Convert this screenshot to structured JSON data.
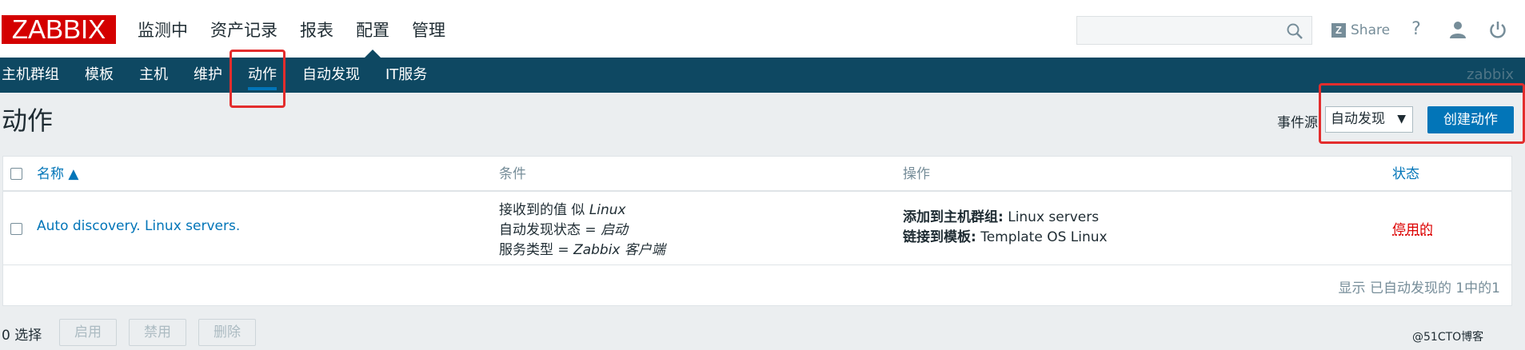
{
  "header": {
    "logo": "ZABBIX",
    "menu": [
      {
        "label": "监测中"
      },
      {
        "label": "资产记录"
      },
      {
        "label": "报表"
      },
      {
        "label": "配置"
      },
      {
        "label": "管理"
      }
    ],
    "search_value": "",
    "share_label": "Share",
    "help_label": "?"
  },
  "subnav": {
    "items": [
      {
        "label": "主机群组"
      },
      {
        "label": "模板"
      },
      {
        "label": "主机"
      },
      {
        "label": "维护"
      },
      {
        "label": "动作"
      },
      {
        "label": "自动发现"
      },
      {
        "label": "IT服务"
      }
    ],
    "server_name": "zabbix"
  },
  "page": {
    "title": "动作",
    "filter_label": "事件源",
    "filter_value": "自动发现",
    "create_button": "创建动作"
  },
  "table": {
    "columns": {
      "name": "名称 ▲",
      "conditions": "条件",
      "operations": "操作",
      "status": "状态"
    },
    "rows": [
      {
        "name": "Auto discovery. Linux servers.",
        "conditions": [
          {
            "text": "接收到的值 似 ",
            "value": "Linux"
          },
          {
            "text": "自动发现状态 = ",
            "value": "启动"
          },
          {
            "text": "服务类型 = ",
            "value": "Zabbix 客户端"
          }
        ],
        "operations": [
          {
            "label": "添加到主机群组:",
            "value": " Linux servers"
          },
          {
            "label": "链接到模板:",
            "value": " Template OS Linux"
          }
        ],
        "status": "停用的"
      }
    ],
    "footer": "显示 已自动发现的 1中的1"
  },
  "bottom": {
    "selected": "0 选择",
    "buttons": [
      {
        "label": "启用"
      },
      {
        "label": "禁用"
      },
      {
        "label": "删除"
      }
    ]
  },
  "watermark": "@51CTO博客",
  "colors": {
    "logo_red": "#d40000",
    "subnav_bg": "#0e4862",
    "accent_blue": "#0275b8",
    "status_disabled_red": "#dc0000",
    "highlight_box_red": "#e32d2d"
  }
}
